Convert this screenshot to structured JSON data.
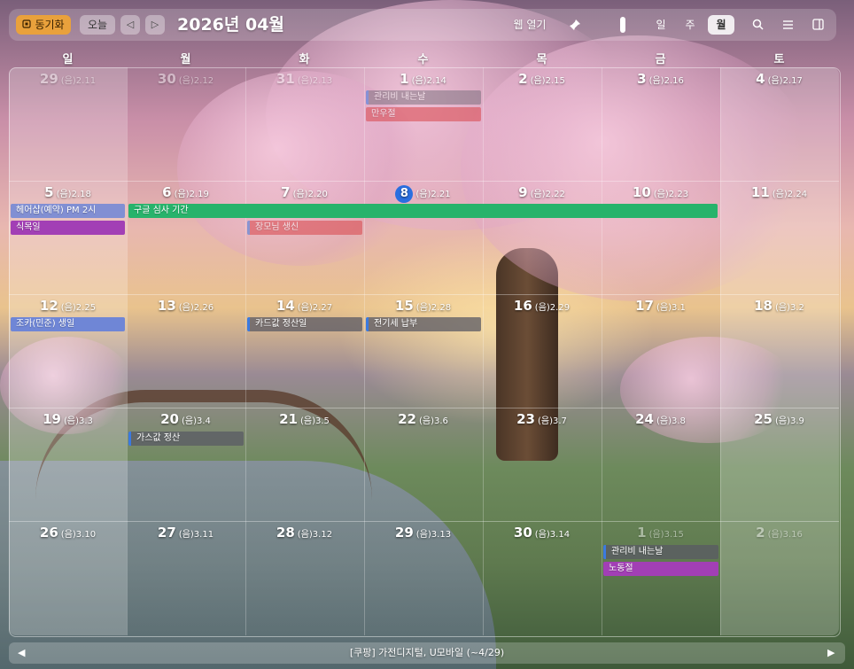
{
  "toolbar": {
    "sync_label": "동기화",
    "today_label": "오늘",
    "prev": "◁",
    "next": "▷",
    "title": "2026년 04월",
    "web_open": "웹 열기",
    "views": [
      "일",
      "주",
      "월"
    ],
    "active_view": "월"
  },
  "weekdays": [
    "일",
    "월",
    "화",
    "수",
    "목",
    "금",
    "토"
  ],
  "weeks": [
    [
      {
        "day": "29",
        "lunar": "(음)2.11"
      },
      {
        "day": "30",
        "lunar": "(음)2.12"
      },
      {
        "day": "31",
        "lunar": "(음)2.13"
      },
      {
        "day": "1",
        "lunar": "(음)2.14"
      },
      {
        "day": "2",
        "lunar": "(음)2.15"
      },
      {
        "day": "3",
        "lunar": "(음)2.16"
      },
      {
        "day": "4",
        "lunar": "(음)2.17"
      }
    ],
    [
      {
        "day": "5",
        "lunar": "(음)2.18"
      },
      {
        "day": "6",
        "lunar": "(음)2.19"
      },
      {
        "day": "7",
        "lunar": "(음)2.20"
      },
      {
        "day": "8",
        "lunar": "(음)2.21"
      },
      {
        "day": "9",
        "lunar": "(음)2.22"
      },
      {
        "day": "10",
        "lunar": "(음)2.23"
      },
      {
        "day": "11",
        "lunar": "(음)2.24"
      }
    ],
    [
      {
        "day": "12",
        "lunar": "(음)2.25"
      },
      {
        "day": "13",
        "lunar": "(음)2.26"
      },
      {
        "day": "14",
        "lunar": "(음)2.27"
      },
      {
        "day": "15",
        "lunar": "(음)2.28"
      },
      {
        "day": "16",
        "lunar": "(음)2.29"
      },
      {
        "day": "17",
        "lunar": "(음)3.1"
      },
      {
        "day": "18",
        "lunar": "(음)3.2"
      }
    ],
    [
      {
        "day": "19",
        "lunar": "(음)3.3"
      },
      {
        "day": "20",
        "lunar": "(음)3.4"
      },
      {
        "day": "21",
        "lunar": "(음)3.5"
      },
      {
        "day": "22",
        "lunar": "(음)3.6"
      },
      {
        "day": "23",
        "lunar": "(음)3.7"
      },
      {
        "day": "24",
        "lunar": "(음)3.8"
      },
      {
        "day": "25",
        "lunar": "(음)3.9"
      }
    ],
    [
      {
        "day": "26",
        "lunar": "(음)3.10"
      },
      {
        "day": "27",
        "lunar": "(음)3.11"
      },
      {
        "day": "28",
        "lunar": "(음)3.12"
      },
      {
        "day": "29",
        "lunar": "(음)3.13"
      },
      {
        "day": "30",
        "lunar": "(음)3.14"
      },
      {
        "day": "1",
        "lunar": "(음)3.15"
      },
      {
        "day": "2",
        "lunar": "(음)3.16"
      }
    ]
  ],
  "events": {
    "e1": "관리비 내는날",
    "e2": "만우절",
    "e3": "헤어샵(예약) PM 2시",
    "e4": "식목일",
    "e5": "구글 심사 기간",
    "e6": "장모님 생신",
    "e7": "조카(민준) 생일",
    "e8": "카드값 정산일",
    "e9": "전기세 납부",
    "e10": "가스값 정산",
    "e11": "관리비 내는날",
    "e12": "노동절"
  },
  "colors": {
    "accent_orange": "#e9a13c",
    "today_blue": "#2a6fe0",
    "green": "#27b36b",
    "red": "#d9454a",
    "purple": "#a23fb5",
    "blue": "#6f86d6",
    "gray": "#5a5a64"
  },
  "icons": [
    "sync-icon",
    "pin-icon",
    "search-icon",
    "list-icon",
    "panel-icon",
    "left-arrow-icon",
    "right-arrow-icon"
  ],
  "footer": {
    "text": "[쿠팡] 가전디지털, U모바일 (~4/29)"
  }
}
